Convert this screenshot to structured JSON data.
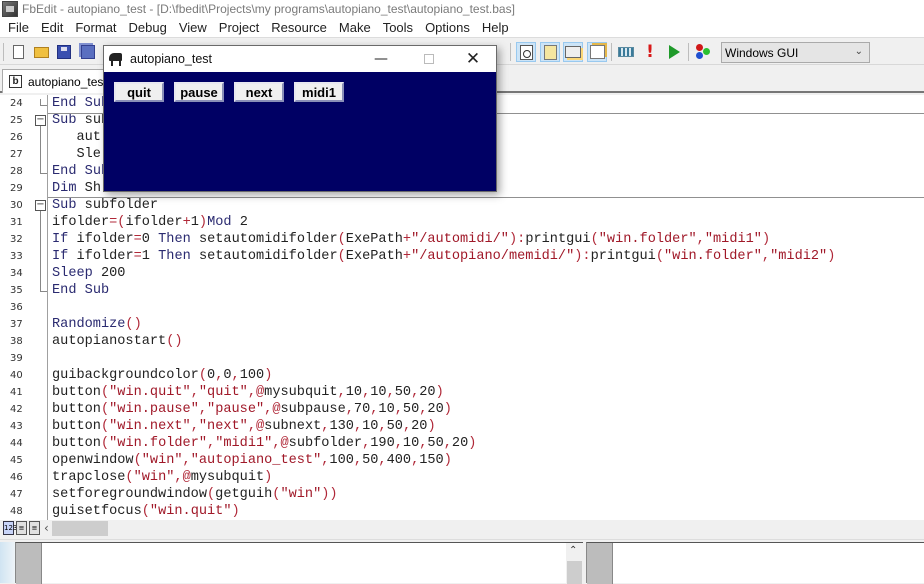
{
  "app": {
    "title": "FbEdit - autopiano_test - [D:\\fbedit\\Projects\\my programs\\autopiano_test\\autopiano_test.bas]"
  },
  "menu": [
    "File",
    "Edit",
    "Format",
    "Debug",
    "View",
    "Project",
    "Resource",
    "Make",
    "Tools",
    "Options",
    "Help"
  ],
  "toolbar": {
    "buttons": [
      "new-file",
      "open-file",
      "save-file",
      "save-all",
      "find",
      "find-next",
      "window-list",
      "properties",
      "compile",
      "error",
      "run",
      "make-options"
    ],
    "build_config": "Windows GUI"
  },
  "tabs": [
    {
      "label": "autopiano_test",
      "active": true
    }
  ],
  "editor": {
    "lines": [
      {
        "n": "24",
        "text": "End Sub"
      },
      {
        "n": "25",
        "text": "Sub sub"
      },
      {
        "n": "26",
        "text": "   aut"
      },
      {
        "n": "27",
        "text": "   Sle"
      },
      {
        "n": "28",
        "text": "End Sub"
      },
      {
        "n": "29",
        "text": "Dim Sh"
      },
      {
        "n": "30",
        "text": "Sub subfolder"
      },
      {
        "n": "31",
        "text": "ifolder=(ifolder+1)Mod 2"
      },
      {
        "n": "32",
        "text": "If ifolder=0 Then setautomidifolder(ExePath+\"/automidi/\"):printgui(\"win.folder\",\"midi1\")"
      },
      {
        "n": "33",
        "text": "If ifolder=1 Then setautomidifolder(ExePath+\"/autopiano/memidi/\"):printgui(\"win.folder\",\"midi2\")"
      },
      {
        "n": "34",
        "text": "Sleep 200"
      },
      {
        "n": "35",
        "text": "End Sub"
      },
      {
        "n": "36",
        "text": ""
      },
      {
        "n": "37",
        "text": "Randomize()"
      },
      {
        "n": "38",
        "text": "autopianostart()"
      },
      {
        "n": "39",
        "text": ""
      },
      {
        "n": "40",
        "text": "guibackgroundcolor(0,0,100)"
      },
      {
        "n": "41",
        "text": "button(\"win.quit\",\"quit\",@mysubquit,10,10,50,20)"
      },
      {
        "n": "42",
        "text": "button(\"win.pause\",\"pause\",@subpause,70,10,50,20)"
      },
      {
        "n": "43",
        "text": "button(\"win.next\",\"next\",@subnext,130,10,50,20)"
      },
      {
        "n": "44",
        "text": "button(\"win.folder\",\"midi1\",@subfolder,190,10,50,20)"
      },
      {
        "n": "45",
        "text": "openwindow(\"win\",\"autopiano_test\",100,50,400,150)"
      },
      {
        "n": "46",
        "text": "trapclose(\"win\",@mysubquit)"
      },
      {
        "n": "47",
        "text": "setforegroundwindow(getguih(\"win\"))"
      },
      {
        "n": "48",
        "text": "guisetfocus(\"win.quit\")"
      }
    ]
  },
  "gui_window": {
    "title": "autopiano_test",
    "background": "#000064",
    "buttons": [
      "quit",
      "pause",
      "next",
      "midi1"
    ]
  },
  "colors": {
    "code_keyword": "#2a2a70",
    "code_string": "#a01828",
    "gui_background": "#000064",
    "run_icon": "#1f9a2a",
    "error_icon": "#d81818"
  }
}
